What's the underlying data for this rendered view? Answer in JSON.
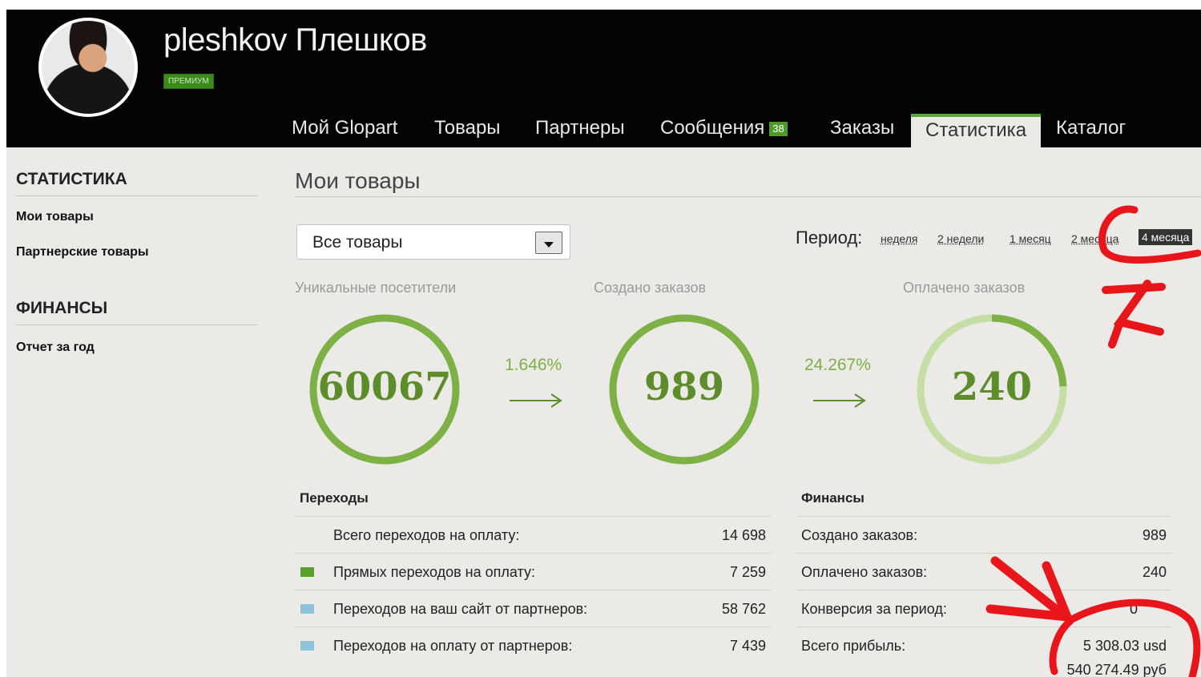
{
  "header": {
    "username": "pleshkov Плешков",
    "badge": "ПРЕМИУМ",
    "nav": [
      {
        "label": "Мой Glopart"
      },
      {
        "label": "Товары"
      },
      {
        "label": "Партнеры"
      },
      {
        "label": "Сообщения",
        "count": "38"
      },
      {
        "label": "Заказы"
      },
      {
        "label": "Статистика",
        "active": true
      },
      {
        "label": "Каталог"
      }
    ]
  },
  "sidebar": {
    "section1": {
      "title": "СТАТИСТИКА",
      "items": [
        {
          "label": "Мои товары"
        },
        {
          "label": "Партнерские товары"
        }
      ]
    },
    "section2": {
      "title": "ФИНАНСЫ",
      "items": [
        {
          "label": "Отчет за год"
        }
      ]
    }
  },
  "main": {
    "title": "Мои товары",
    "product_select": {
      "value": "Все товары"
    },
    "period": {
      "label": "Период:",
      "options": [
        "неделя",
        "2 недели",
        "1 месяц",
        "2 месяца",
        "4 месяца"
      ],
      "selected": "4 месяца"
    },
    "funnel": [
      {
        "label": "Уникальные посетители",
        "value": "60067",
        "fill": 1.0
      },
      {
        "conversion": "1.646%"
      },
      {
        "label": "Создано заказов",
        "value": "989",
        "fill": 1.0
      },
      {
        "conversion": "24.267%"
      },
      {
        "label": "Оплачено заказов",
        "value": "240",
        "fill": 0.243
      }
    ],
    "transitions": {
      "title": "Переходы",
      "rows": [
        {
          "label": "Всего переходов на оплату:",
          "value": "14 698",
          "color": ""
        },
        {
          "label": "Прямых переходов на оплату:",
          "value": "7 259",
          "color": "#5aa02c"
        },
        {
          "label": "Переходов на ваш сайт от партнеров:",
          "value": "58 762",
          "color": "#8cc3d9"
        },
        {
          "label": "Переходов на оплату от партнеров:",
          "value": "7 439",
          "color": "#8cc3d9"
        }
      ]
    },
    "finances": {
      "title": "Финансы",
      "rows": [
        {
          "label": "Создано заказов:",
          "value": "989"
        },
        {
          "label": "Оплачено заказов:",
          "value": "240"
        },
        {
          "label": "Конверсия за период:",
          "value": "0"
        },
        {
          "label": "Всего прибыль:",
          "value": "5 308.03 usd",
          "value2": "540 274.49 руб"
        }
      ]
    }
  },
  "colors": {
    "accent": "#56a836",
    "ring": "#7db045",
    "ring_light": "#c5dea6",
    "annotation": "#e8161b"
  }
}
